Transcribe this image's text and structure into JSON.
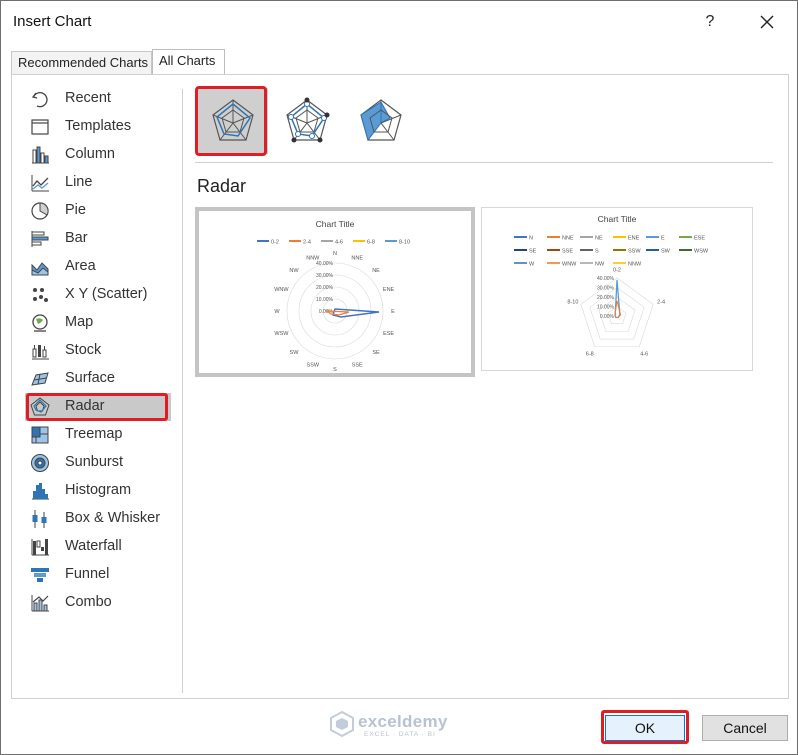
{
  "dialog": {
    "title": "Insert Chart",
    "help": "?",
    "close": "close"
  },
  "tabs": [
    {
      "label": "Recommended Charts",
      "active": false
    },
    {
      "label": "All Charts",
      "active": true
    }
  ],
  "sidebar": {
    "items": [
      {
        "label": "Recent",
        "icon": "recent-icon"
      },
      {
        "label": "Templates",
        "icon": "templates-icon"
      },
      {
        "label": "Column",
        "icon": "column-chart-icon"
      },
      {
        "label": "Line",
        "icon": "line-chart-icon"
      },
      {
        "label": "Pie",
        "icon": "pie-chart-icon"
      },
      {
        "label": "Bar",
        "icon": "bar-chart-icon"
      },
      {
        "label": "Area",
        "icon": "area-chart-icon"
      },
      {
        "label": "X Y (Scatter)",
        "icon": "scatter-chart-icon"
      },
      {
        "label": "Map",
        "icon": "map-chart-icon"
      },
      {
        "label": "Stock",
        "icon": "stock-chart-icon"
      },
      {
        "label": "Surface",
        "icon": "surface-chart-icon"
      },
      {
        "label": "Radar",
        "icon": "radar-chart-icon",
        "selected": true
      },
      {
        "label": "Treemap",
        "icon": "treemap-chart-icon"
      },
      {
        "label": "Sunburst",
        "icon": "sunburst-chart-icon"
      },
      {
        "label": "Histogram",
        "icon": "histogram-chart-icon"
      },
      {
        "label": "Box & Whisker",
        "icon": "box-whisker-chart-icon"
      },
      {
        "label": "Waterfall",
        "icon": "waterfall-chart-icon"
      },
      {
        "label": "Funnel",
        "icon": "funnel-chart-icon"
      },
      {
        "label": "Combo",
        "icon": "combo-chart-icon"
      }
    ]
  },
  "subtypes": [
    {
      "icon": "radar-icon",
      "selected": true
    },
    {
      "icon": "radar-markers-icon",
      "selected": false
    },
    {
      "icon": "filled-radar-icon",
      "selected": false
    }
  ],
  "section_title": "Radar",
  "previews": [
    {
      "title": "Chart Title",
      "legend": [
        "0-2",
        "2-4",
        "4-6",
        "6-8",
        "8-10"
      ],
      "legend_colors": [
        "#4472c4",
        "#ed7d31",
        "#a5a5a5",
        "#ffc000",
        "#5b9bd5"
      ],
      "axis_ticks": [
        "40.00%",
        "30.00%",
        "20.00%",
        "10.00%",
        "0.00%"
      ],
      "categories": [
        "N",
        "NNE",
        "NE",
        "ENE",
        "E",
        "ESE",
        "SE",
        "SSE",
        "S",
        "SSW",
        "SW",
        "WSW",
        "W",
        "WNW",
        "NW",
        "NNW"
      ]
    },
    {
      "title": "Chart Title",
      "legend": [
        "N",
        "NNE",
        "NE",
        "ENE",
        "E",
        "ESE",
        "SE",
        "SSE",
        "S",
        "SSW",
        "SW",
        "WSW",
        "W",
        "WNW",
        "NW",
        "NNW"
      ],
      "legend_colors": [
        "#4472c4",
        "#ed7d31",
        "#a5a5a5",
        "#ffc000",
        "#5b9bd5",
        "#70ad47",
        "#264478",
        "#9e480e",
        "#636363",
        "#997300",
        "#255e91",
        "#43682b",
        "#698ed0",
        "#f1975a",
        "#b7b7b7",
        "#ffcd33"
      ],
      "axis_ticks": [
        "40.00%",
        "30.00%",
        "20.00%",
        "10.00%",
        "0.00%"
      ],
      "categories": [
        "0-2",
        "2-4",
        "4-6",
        "6-8",
        "8-10"
      ]
    }
  ],
  "watermark": {
    "name": "exceldemy",
    "tagline": "EXCEL · DATA · BI"
  },
  "buttons": {
    "ok": "OK",
    "cancel": "Cancel"
  },
  "colors": {
    "selection_highlight": "#e01c24",
    "accent": "#4472c4"
  }
}
